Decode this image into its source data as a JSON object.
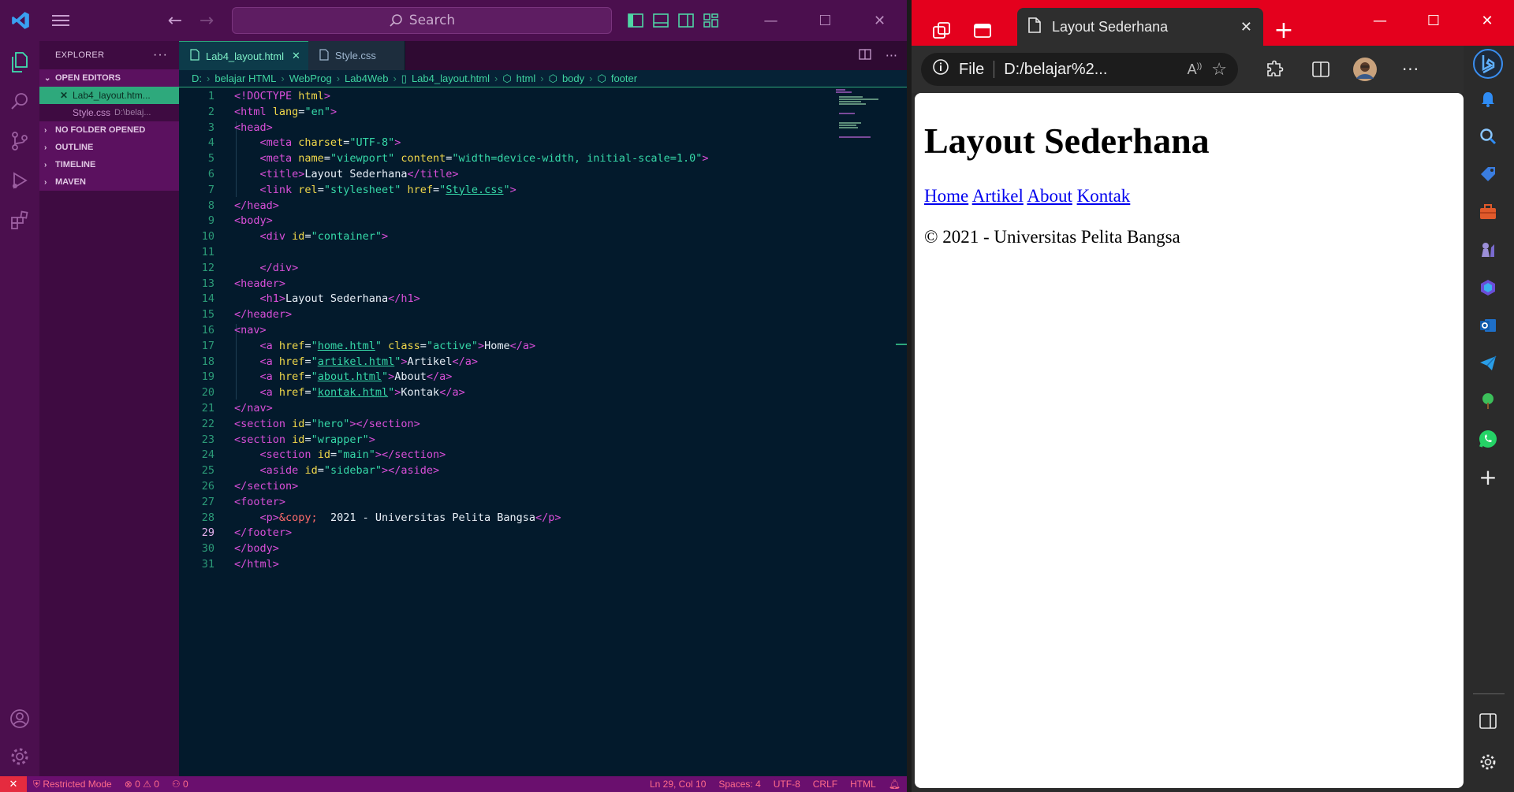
{
  "vscode": {
    "search_placeholder": "Search",
    "explorer_title": "EXPLORER",
    "sections": {
      "open_editors": "OPEN EDITORS",
      "no_folder": "NO FOLDER OPENED",
      "outline": "OUTLINE",
      "timeline": "TIMELINE",
      "maven": "MAVEN"
    },
    "open_files": [
      {
        "name": "Lab4_layout.htm..."
      },
      {
        "name": "Style.css",
        "path": "D:\\belaj..."
      }
    ],
    "tabs": [
      {
        "label": "Lab4_layout.html"
      },
      {
        "label": "Style.css"
      }
    ],
    "breadcrumb": [
      "D:",
      "belajar HTML",
      "WebProg",
      "Lab4Web",
      "Lab4_layout.html",
      "html",
      "body",
      "footer"
    ],
    "line_numbers": [
      "1",
      "2",
      "3",
      "4",
      "5",
      "6",
      "7",
      "8",
      "9",
      "10",
      "11",
      "12",
      "13",
      "14",
      "15",
      "16",
      "17",
      "18",
      "19",
      "20",
      "21",
      "22",
      "23",
      "24",
      "25",
      "26",
      "27",
      "28",
      "29",
      "30",
      "31"
    ],
    "status": {
      "restricted": "Restricted Mode",
      "problems": "0 ⚠ 0",
      "ports": "0",
      "position": "Ln 29, Col 10",
      "spaces": "Spaces: 4",
      "encoding": "UTF-8",
      "eol": "CRLF",
      "language": "HTML"
    }
  },
  "edge": {
    "tab_title": "Layout Sederhana",
    "address_scheme": "File",
    "address_url": "D:/belajar%2...",
    "page": {
      "heading": "Layout Sederhana",
      "links": [
        "Home",
        "Artikel",
        "About",
        "Kontak"
      ],
      "footer": "© 2021 - Universitas Pelita Bangsa"
    }
  },
  "colors": {
    "vscode_title": "#4b0f4e",
    "editor_bg": "#031a2c",
    "accent_green": "#2ea97c",
    "edge_red": "#e4001d",
    "status_bar": "#6a0f6e"
  }
}
